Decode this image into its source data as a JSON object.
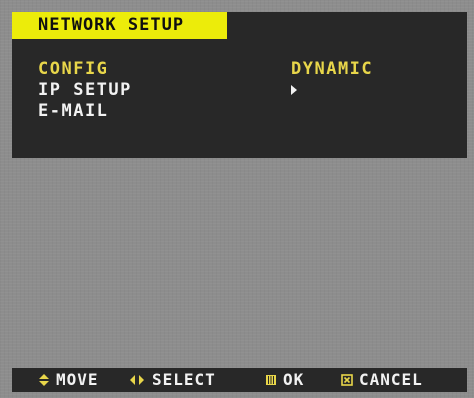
{
  "menu": {
    "title": "NETWORK SETUP",
    "items": [
      {
        "label": "CONFIG",
        "value": "DYNAMIC",
        "selected": true
      },
      {
        "label": "IP SETUP",
        "value_icon": "arrow-right-icon",
        "selected": false
      },
      {
        "label": "E-MAIL",
        "selected": false
      }
    ]
  },
  "status_bar": {
    "hints": [
      {
        "icon": "up-down-arrows-icon",
        "label": "MOVE"
      },
      {
        "icon": "left-right-arrows-icon",
        "label": "SELECT"
      },
      {
        "icon": "ok-button-icon",
        "label": "OK"
      },
      {
        "icon": "cancel-button-icon",
        "label": "CANCEL"
      }
    ]
  },
  "colors": {
    "panel_background": "#282828",
    "title_background": "#ecec0a",
    "selected_text": "#e8d64a",
    "normal_text": "#f2f2f2",
    "screen_background": "#8d8d8d"
  }
}
